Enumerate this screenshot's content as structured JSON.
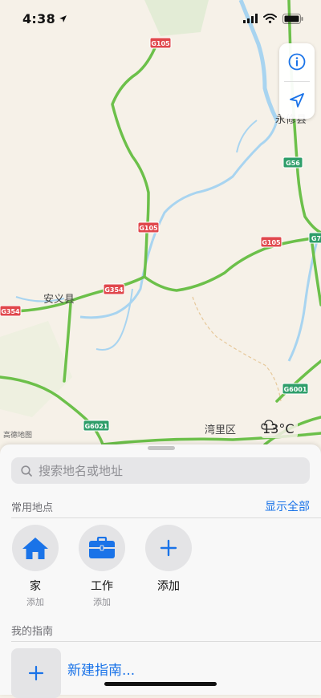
{
  "status_bar": {
    "time": "4:38"
  },
  "map": {
    "labels": {
      "county_top": "永修县",
      "county_left": "安义县",
      "district": "湾里区"
    },
    "shields": {
      "g105_top": "G105",
      "g105_mid": "G105",
      "g105_right": "G105",
      "g354_mid": "G354",
      "g354_left": "G354",
      "g56": "G56",
      "g6001": "G6001",
      "g6021": "G6021",
      "g7_edge": "G7"
    },
    "attribution": "高德地图",
    "weather": {
      "temperature": "13°C"
    },
    "colors": {
      "road_green": "#6cc04a",
      "shield_red": "#e0474c",
      "shield_green": "#2e9e6a",
      "water": "#a8d4f0"
    }
  },
  "sheet": {
    "search": {
      "placeholder": "搜索地名或地址"
    },
    "favorites": {
      "title": "常用地点",
      "show_all": "显示全部",
      "items": [
        {
          "label": "家",
          "sub": "添加",
          "icon": "home-icon"
        },
        {
          "label": "工作",
          "sub": "添加",
          "icon": "briefcase-icon"
        },
        {
          "label": "添加",
          "sub": "",
          "icon": "plus-icon"
        }
      ]
    },
    "guides": {
      "title": "我的指南",
      "new_guide": "新建指南..."
    }
  }
}
